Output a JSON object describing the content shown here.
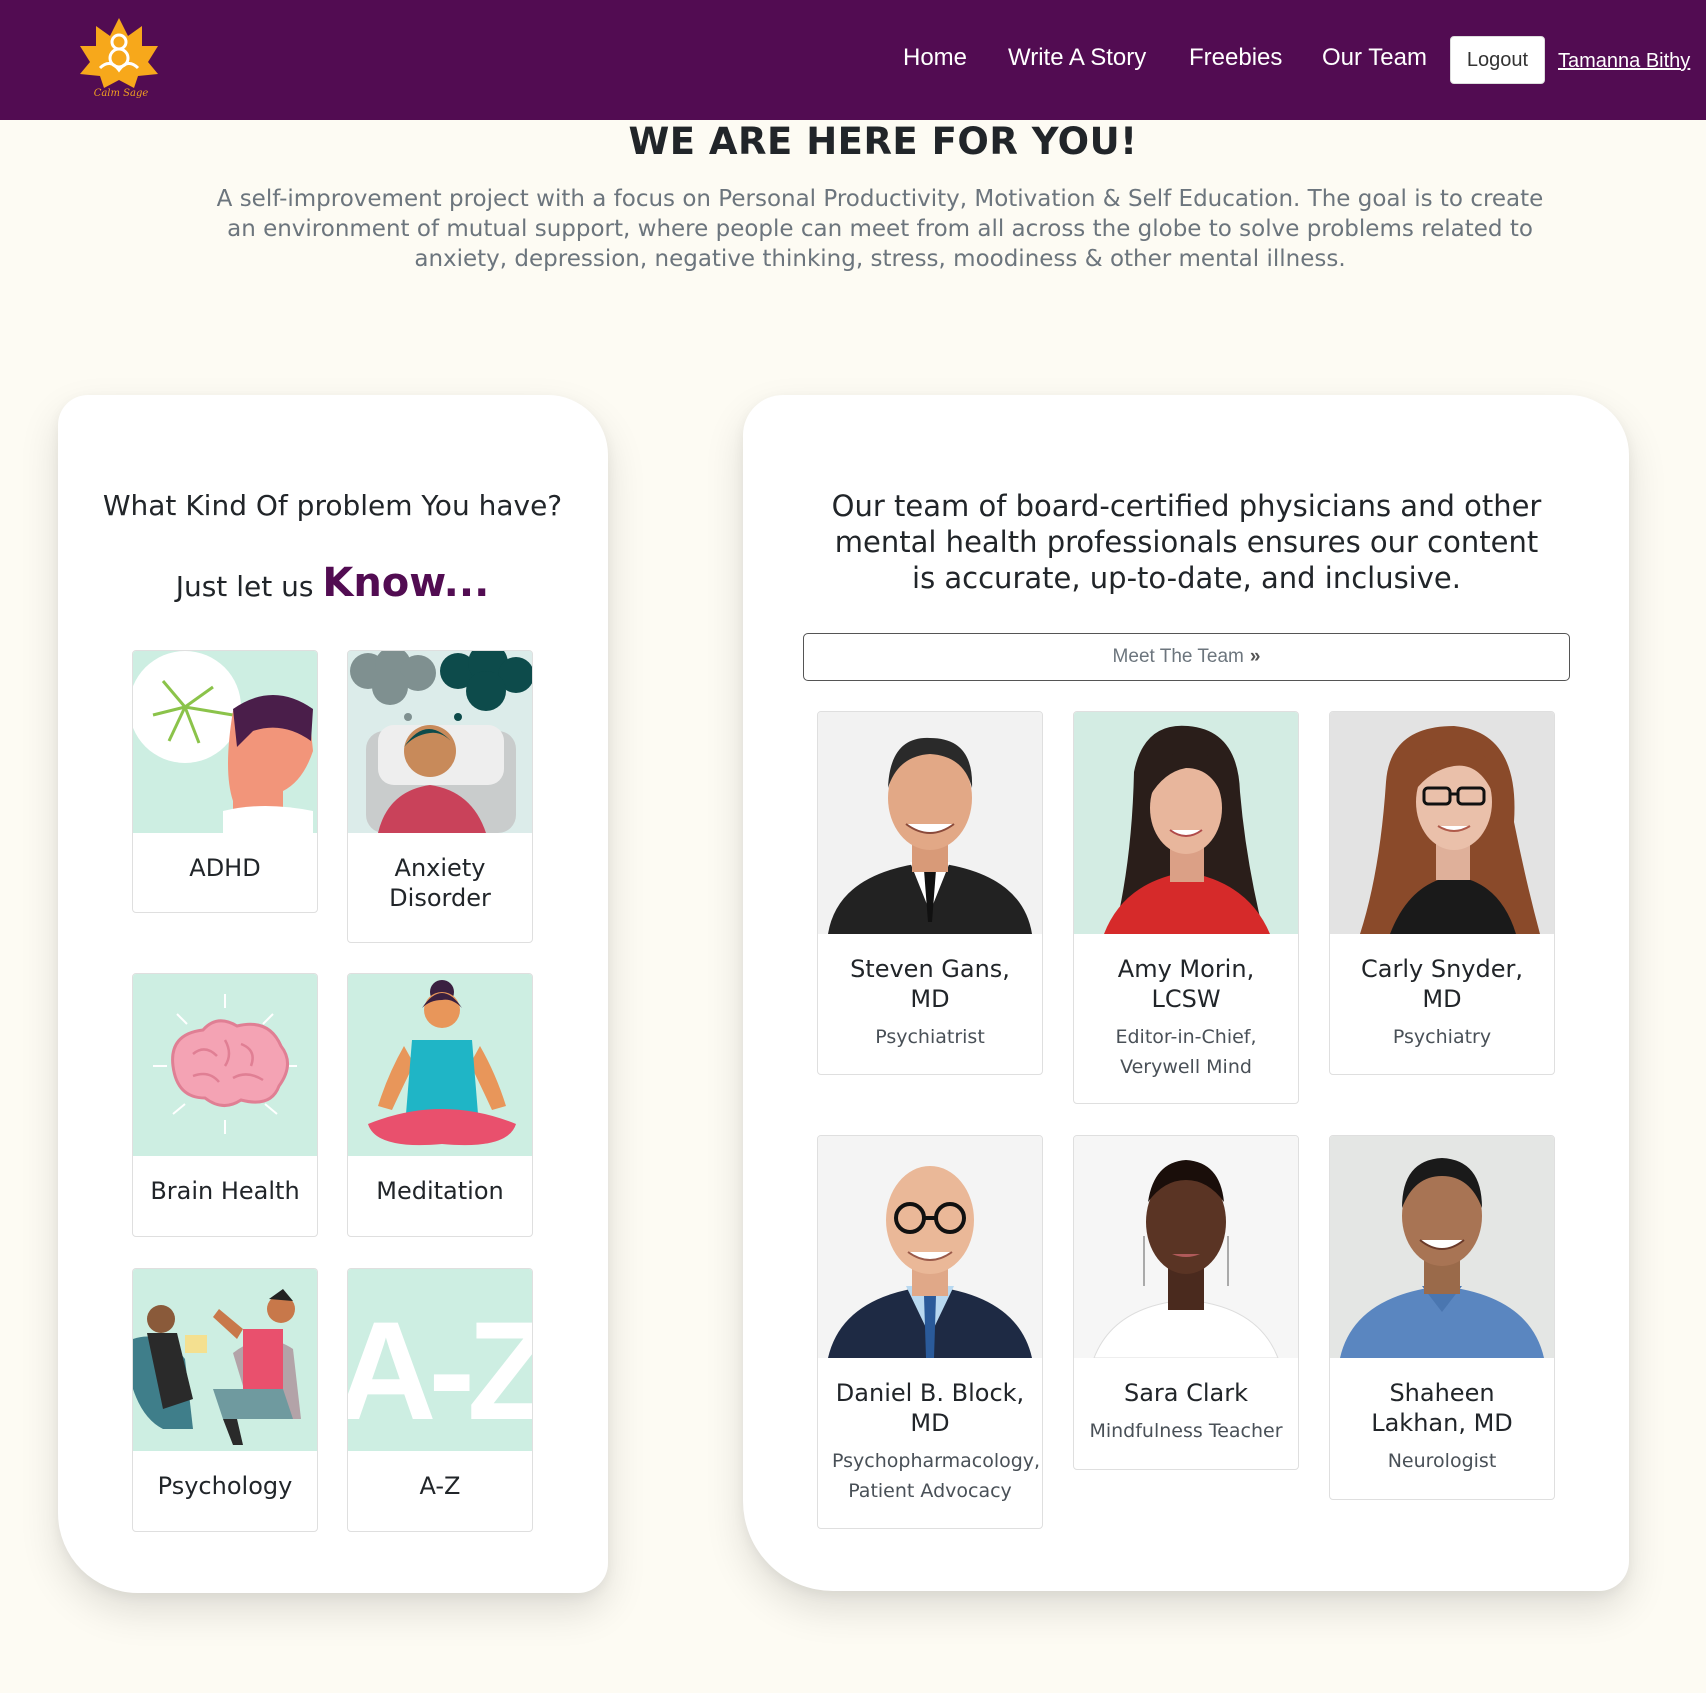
{
  "nav": {
    "logo_text": "Calm Sage",
    "links": [
      "Home",
      "Write A Story",
      "Freebies",
      "Our Team"
    ],
    "logout_label": "Logout",
    "user_name": "Tamanna Bithy"
  },
  "hero": {
    "title": "WE ARE HERE FOR YOU!",
    "text": "A self-improvement project with a focus on Personal Productivity, Motivation & Self Education. The goal is to create an environment of mutual support, where people can meet from all across the globe to solve problems related to anxiety, depression, negative thinking, stress, moodiness & other mental illness."
  },
  "problems": {
    "heading": "What Kind Of problem You have?",
    "sub_prefix": "Just let us",
    "sub_emphasis": "Know...",
    "items": [
      {
        "label": "ADHD",
        "icon": "adhd-illustration"
      },
      {
        "label": "Anxiety Disorder",
        "icon": "anxiety-illustration"
      },
      {
        "label": "Brain Health",
        "icon": "brain-illustration"
      },
      {
        "label": "Meditation",
        "icon": "meditation-illustration"
      },
      {
        "label": "Psychology",
        "icon": "psychology-illustration"
      },
      {
        "label": "A-Z",
        "icon": "a-z-illustration"
      }
    ]
  },
  "team": {
    "heading": "Our team of board-certified physicians and other mental health professionals ensures our content is accurate, up-to-date, and inclusive.",
    "meet_label": "Meet The Team",
    "members": [
      {
        "name": "Steven Gans, MD",
        "role": "Psychiatrist"
      },
      {
        "name": "Amy Morin, LCSW",
        "role": "Editor-in-Chief, Verywell Mind"
      },
      {
        "name": "Carly Snyder, MD",
        "role": "Psychiatry"
      },
      {
        "name": "Daniel B. Block, MD",
        "role": "Psychopharmacology, Patient Advocacy"
      },
      {
        "name": "Sara Clark",
        "role": "Mindfulness Teacher"
      },
      {
        "name": "Shaheen Lakhan, MD",
        "role": "Neurologist"
      }
    ]
  },
  "colors": {
    "brand": "#520c52",
    "background": "#fdfbf3",
    "tile_bg": "#cdeee2"
  }
}
